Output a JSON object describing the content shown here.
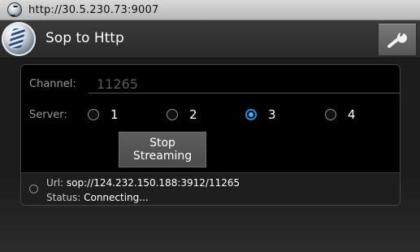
{
  "browser": {
    "url": "http://30.5.230.73:9007"
  },
  "titlebar": {
    "title": "Sop to Http",
    "settings_icon": "wrench-icon",
    "logo_icon": "sopcast-logo-icon"
  },
  "form": {
    "channel_label": "Channel:",
    "channel_value": "11265",
    "server_label": "Server:",
    "server_options": [
      "1",
      "2",
      "3",
      "4"
    ],
    "server_selected": "3"
  },
  "action": {
    "stop_line1": "Stop",
    "stop_line2": "Streaming"
  },
  "status": {
    "url_key": "Url:",
    "url_value": "sop://124.232.150.188:3912/11265",
    "status_key": "Status:",
    "status_value": "Connecting..."
  },
  "colors": {
    "accent": "#39b3ff",
    "titlebar": "#333333",
    "panel": "#000000"
  }
}
